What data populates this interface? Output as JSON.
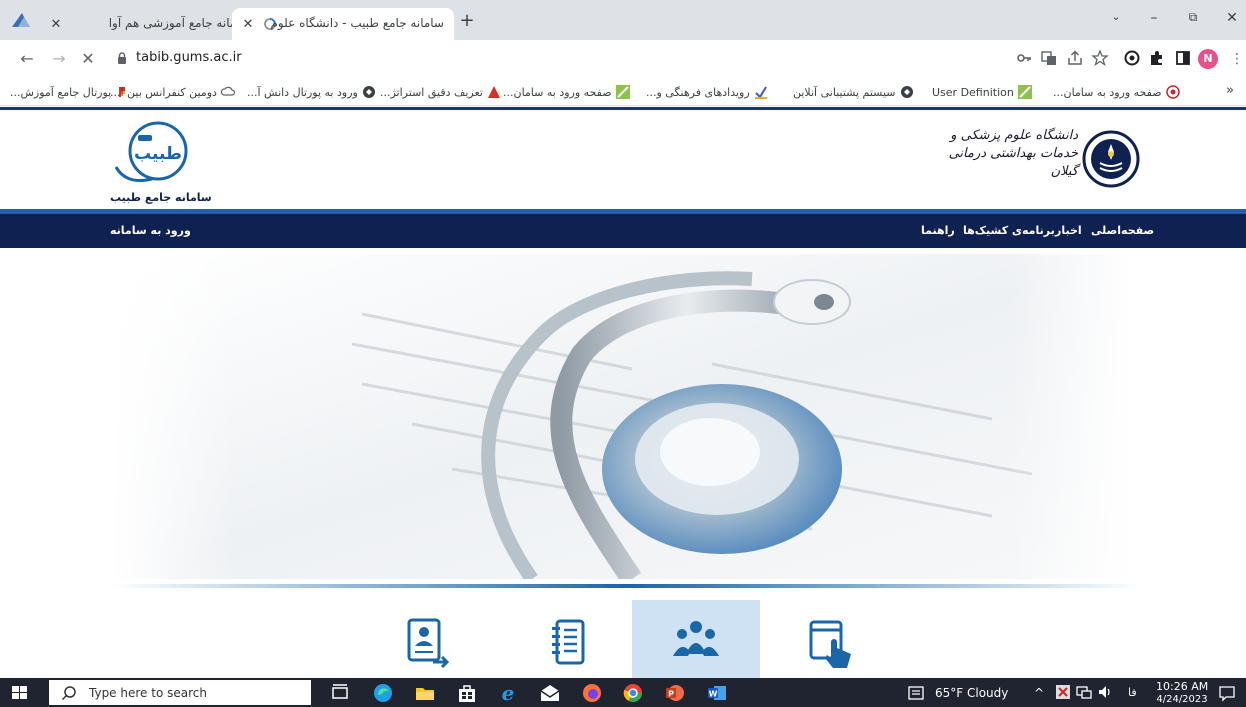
{
  "browser": {
    "tabs": [
      {
        "title": "سامانه جامع آموزشی هم آوا",
        "active": false
      },
      {
        "title": "سامانه جامع طبیب - دانشگاه علوم",
        "active": true
      }
    ],
    "new_tab": "+",
    "url": "tabib.gums.ac.ir",
    "bookmarks": [
      "پورتال جامع آموزش...",
      "دومین کنفرانس بین ا...",
      "ورود به پورتال دانش آ...",
      "تعریف دقیق استراتژ...",
      "صفحه ورود به سامان...",
      "رویدادهای فرهنگی و...",
      "سیستم پشتیبانی آنلاین",
      "User Definition",
      "صفحه ورود به سامان..."
    ],
    "bookmarks_overflow": "»",
    "profile_initial": "N"
  },
  "site": {
    "logo_text": "طبیب",
    "system_name": "سامانه جامع طبیب",
    "university_line1": "دانشگاه علوم پزشکی و",
    "university_line2": "خدمات بهداشتی درمانی گیلان",
    "nav": {
      "home": "صفحه‌اصلی",
      "news": "اخبار",
      "shifts": "برنامه‌ی کشیک‌ها",
      "guide": "راهنما",
      "login": "ورود به سامانه"
    }
  },
  "taskbar": {
    "search_placeholder": "Type here to search",
    "weather": "65°F  Cloudy",
    "lang": "فا",
    "time": "10:26 AM",
    "date": "4/24/2023"
  },
  "colors": {
    "navbar": "#0f2150",
    "accent": "#1b66a8",
    "active_service": "#cfe2f3"
  }
}
